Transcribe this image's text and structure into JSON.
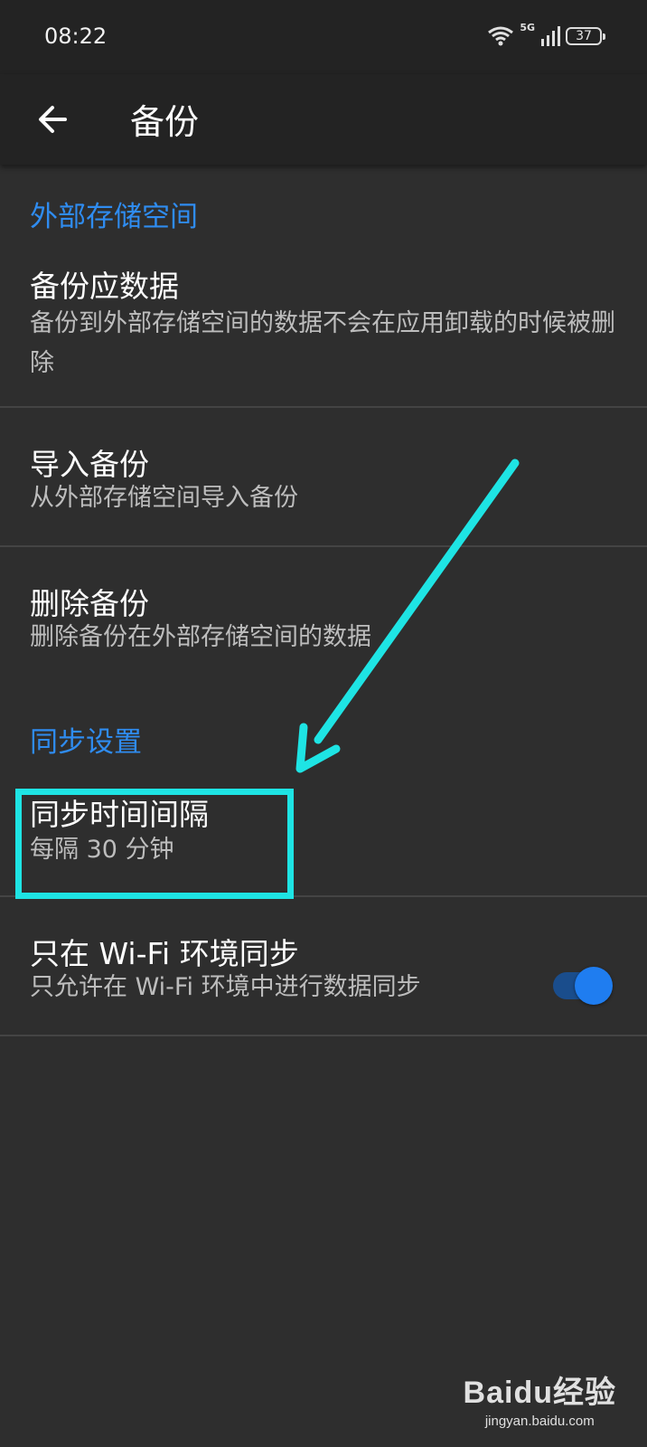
{
  "status_bar": {
    "time": "08:22",
    "network": "5G",
    "battery": "37"
  },
  "app_bar": {
    "title": "备份",
    "back_icon": "arrow-left-icon"
  },
  "sections": [
    {
      "header": "外部存储空间"
    },
    {
      "header": "同步设置"
    }
  ],
  "items": [
    {
      "title": "备份应数据",
      "summary": "备份到外部存储空间的数据不会在应用卸载的时候被删除"
    },
    {
      "title": "导入备份",
      "summary": "从外部存储空间导入备份"
    },
    {
      "title": "删除备份",
      "summary": "删除备份在外部存储空间的数据"
    },
    {
      "title": "同步时间间隔",
      "summary": "每隔 30 分钟"
    },
    {
      "title": "只在 Wi-Fi 环境同步",
      "summary": "只允许在 Wi-Fi 环境中进行数据同步",
      "toggle_on": true
    }
  ],
  "colors": {
    "accent": "#2f8cf0",
    "annotation": "#1ee4e4",
    "background": "#2e2e2e",
    "bar": "#232323"
  },
  "watermark": {
    "brand": "Baidu经验",
    "url": "jingyan.baidu.com"
  }
}
